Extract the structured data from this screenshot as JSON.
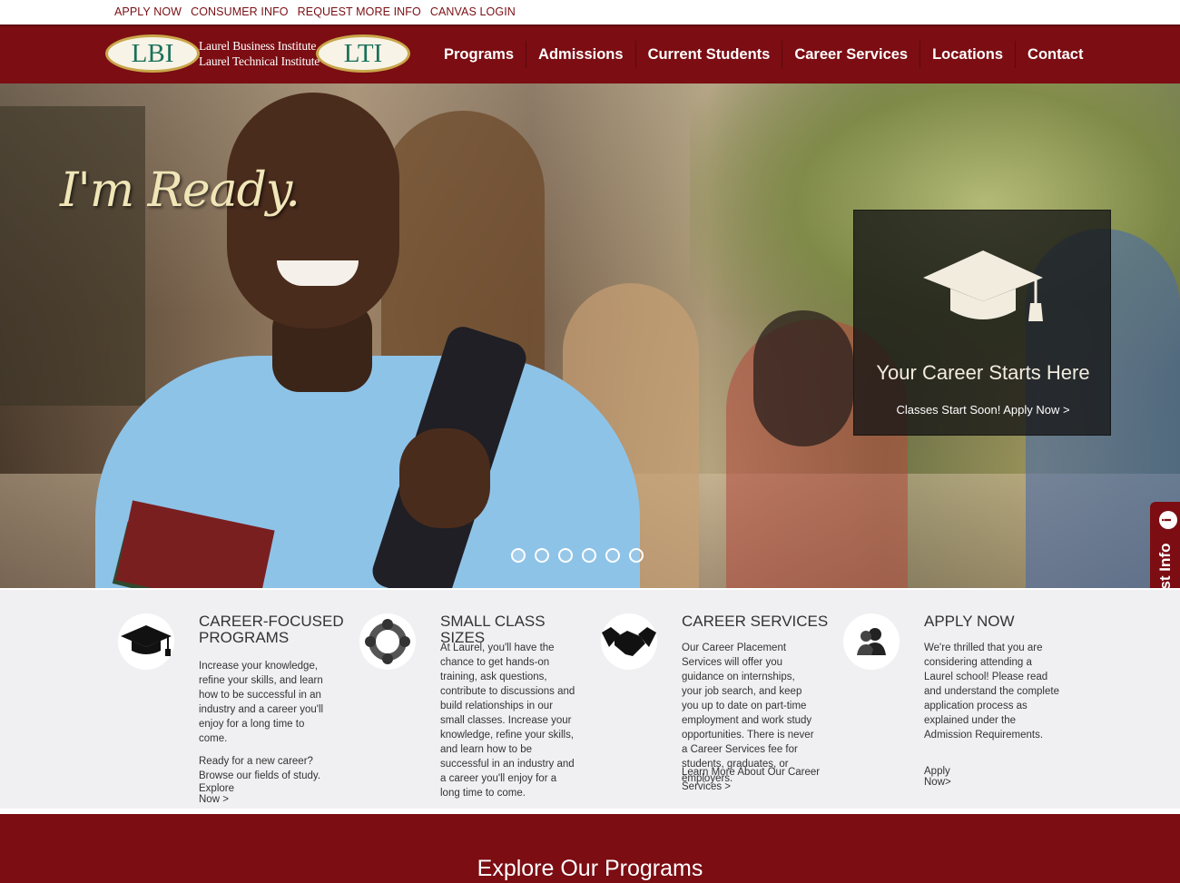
{
  "topbar": {
    "links": [
      "APPLY NOW",
      "CONSUMER INFO",
      "REQUEST MORE INFO",
      "CANVAS LOGIN"
    ]
  },
  "header": {
    "logo_left": "LBI",
    "logo_right": "LTI",
    "logo_line1": "Laurel Business Institute",
    "logo_line2": "Laurel Technical Institute",
    "nav": [
      "Programs",
      "Admissions",
      "Current Students",
      "Career Services",
      "Locations",
      "Contact"
    ]
  },
  "hero": {
    "slogan": "I'm Ready.",
    "box_title": "Your Career Starts Here",
    "box_link": "Classes Start Soon! Apply Now >",
    "slide_count": 6,
    "active_slide": 1
  },
  "request_tab": {
    "label": "Request Info",
    "icon_glyph": "i"
  },
  "features": [
    {
      "icon": "graduation-cap-icon",
      "title": "CAREER-FOCUSED PROGRAMS",
      "body": "Increase your knowledge, refine your skills, and learn how to be successful in an industry and a career you'll enjoy for a long time to come.",
      "body2": "Ready for a new career? Browse our fields of study.",
      "link": "Explore Now >"
    },
    {
      "icon": "people-circle-icon",
      "title": "SMALL CLASS SIZES",
      "body": "At Laurel, you'll have the chance to get hands-on training, ask questions, contribute to discussions and build relationships in our small classes. Increase your knowledge, refine your skills, and learn how to be successful in an industry and a career you'll enjoy for a long time to come.",
      "body2": "",
      "link": ""
    },
    {
      "icon": "handshake-icon",
      "title": "CAREER SERVICES",
      "body": "Our Career Placement Services will offer you guidance on internships, your job search, and keep you up to date on part-time employment and work study opportunities. There is never a Career Services fee for students, graduates, or employers.",
      "body2": "",
      "link": "Learn More About Our Career Services >"
    },
    {
      "icon": "users-icon",
      "title": "APPLY NOW",
      "body": "We're thrilled that you are considering attending a Laurel school! Please read and understand the complete application process as explained under the Admission Requirements.",
      "body2": "",
      "link": "Apply Now>"
    }
  ],
  "bottom": {
    "title": "Explore Our Programs"
  },
  "colors": {
    "brand": "#7b0d13",
    "logo_text": "#19705a",
    "logo_border": "#c9a64a",
    "feature_bg": "#f0f0f2"
  }
}
